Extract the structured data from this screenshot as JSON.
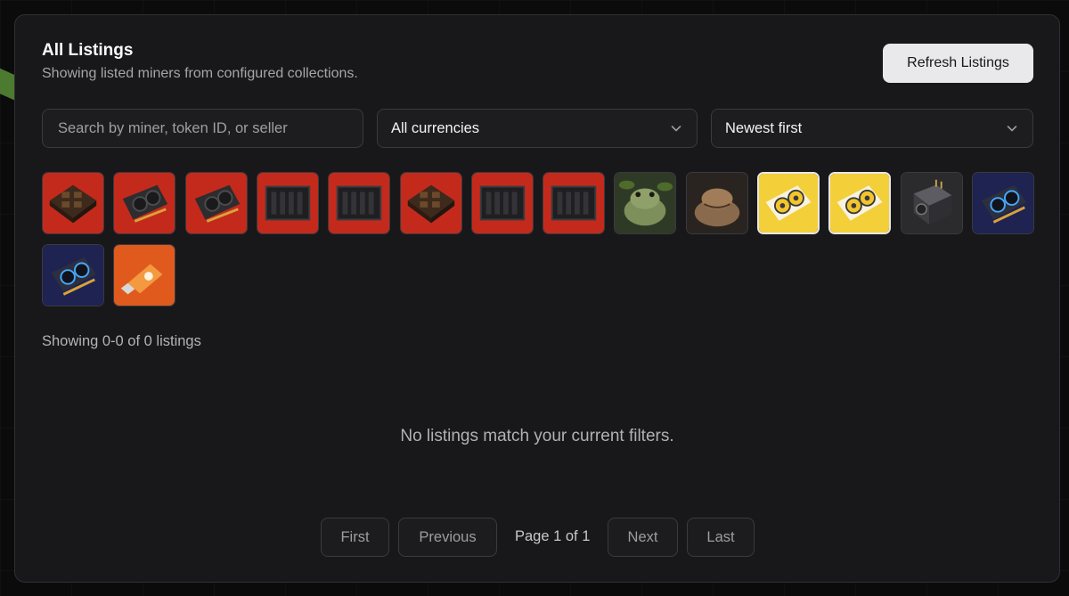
{
  "header": {
    "title": "All Listings",
    "subtitle": "Showing listed miners from configured collections.",
    "refresh_label": "Refresh Listings"
  },
  "filters": {
    "search_placeholder": "Search by miner, token ID, or seller",
    "search_value": "",
    "currency_selected": "All currencies",
    "sort_selected": "Newest first"
  },
  "collections": [
    {
      "kind": "rig-board",
      "bg": "#c42a1c",
      "selected": false
    },
    {
      "kind": "gpu-card",
      "bg": "#c42a1c",
      "selected": false
    },
    {
      "kind": "gpu-card",
      "bg": "#c42a1c",
      "selected": false
    },
    {
      "kind": "rig-frame",
      "bg": "#c42a1c",
      "selected": false
    },
    {
      "kind": "rig-frame",
      "bg": "#c42a1c",
      "selected": false
    },
    {
      "kind": "rig-board",
      "bg": "#c42a1c",
      "selected": false
    },
    {
      "kind": "rig-frame",
      "bg": "#c42a1c",
      "selected": false
    },
    {
      "kind": "rig-frame",
      "bg": "#c42a1c",
      "selected": false
    },
    {
      "kind": "toad",
      "bg": "#2f3a26",
      "selected": false
    },
    {
      "kind": "toad-brown",
      "bg": "#2a2420",
      "selected": false
    },
    {
      "kind": "gpu-yellow",
      "bg": "#f3cf3a",
      "selected": true
    },
    {
      "kind": "gpu-yellow",
      "bg": "#f3cf3a",
      "selected": true
    },
    {
      "kind": "asic-box",
      "bg": "#2b2b2e",
      "selected": false
    },
    {
      "kind": "gpu-blue",
      "bg": "#1e2352",
      "selected": false
    },
    {
      "kind": "gpu-blue",
      "bg": "#1e2352",
      "selected": false
    },
    {
      "kind": "usb-stick",
      "bg": "#e05a1e",
      "selected": false
    }
  ],
  "results": {
    "count_text": "Showing 0-0 of 0 listings",
    "empty_text": "No listings match your current filters."
  },
  "pagination": {
    "first": "First",
    "previous": "Previous",
    "page_info": "Page 1 of 1",
    "next": "Next",
    "last": "Last"
  }
}
